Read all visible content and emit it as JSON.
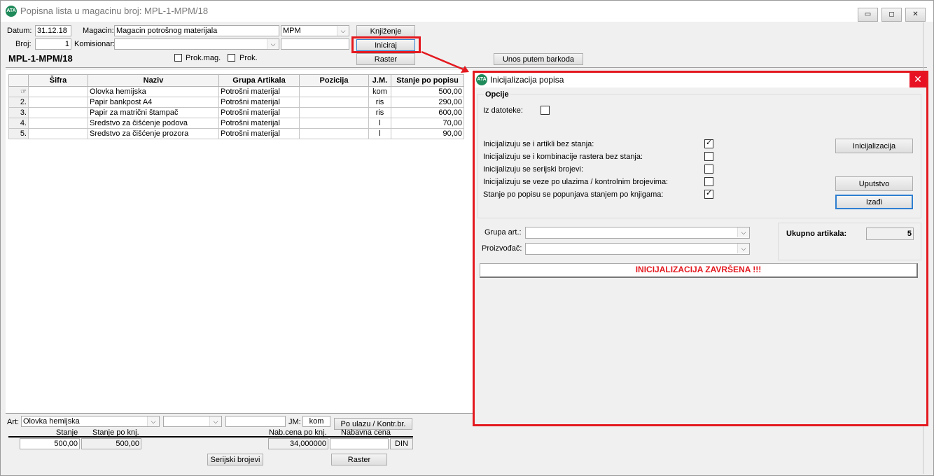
{
  "window": {
    "title": "Popisna lista u magacinu broj: MPL-1-MPM/18",
    "icon": "ATA"
  },
  "header": {
    "datum_label": "Datum:",
    "datum_value": "31.12.18",
    "magacin_label": "Magacin:",
    "magacin_value": "Magacin potrošnog materijala",
    "magacin_code": "MPM",
    "broj_label": "Broj:",
    "broj_value": "1",
    "komisionar_label": "Komisionar:",
    "komisionar_value": "",
    "komisionar_extra": "",
    "doc_number": "MPL-1-MPM/18",
    "prokmag_label": "Prok.mag.",
    "prok_label": "Prok.",
    "knjizenje_btn": "Knjiženje",
    "iniciraj_btn": "Iniciraj",
    "raster_btn": "Raster",
    "barkod_btn": "Unos putem barkoda"
  },
  "grid": {
    "columns": [
      "Šifra",
      "Naziv",
      "Grupa Artikala",
      "Pozicija",
      "J.M.",
      "Stanje po popisu"
    ],
    "rows": [
      {
        "no": "",
        "sifra": "",
        "naziv": "Olovka hemijska",
        "grupa": "Potrošni materijal",
        "pozicija": "",
        "jm": "kom",
        "stanje": "500,00"
      },
      {
        "no": "2.",
        "sifra": "",
        "naziv": "Papir bankpost A4",
        "grupa": "Potrošni materijal",
        "pozicija": "",
        "jm": "ris",
        "stanje": "290,00"
      },
      {
        "no": "3.",
        "sifra": "",
        "naziv": "Papir za matrični štampač",
        "grupa": "Potrošni materijal",
        "pozicija": "",
        "jm": "ris",
        "stanje": "600,00"
      },
      {
        "no": "4.",
        "sifra": "",
        "naziv": "Sredstvo za čišćenje podova",
        "grupa": "Potrošni materijal",
        "pozicija": "",
        "jm": "l",
        "stanje": "70,00"
      },
      {
        "no": "5.",
        "sifra": "",
        "naziv": "Sredstvo za čišćenje prozora",
        "grupa": "Potrošni materijal",
        "pozicija": "",
        "jm": "l",
        "stanje": "90,00"
      }
    ]
  },
  "footer": {
    "art_label": "Art:",
    "art_value": "Olovka hemijska",
    "art_combo2": "",
    "art_text": "",
    "jm_label": "JM:",
    "jm_value": "kom",
    "po_ulazu_btn": "Po ulazu / Kontr.br.",
    "stanje_label": "Stanje",
    "stanje_value": "500,00",
    "stanje_knj_label": "Stanje po knj.",
    "stanje_knj_value": "500,00",
    "nabcena_label": "Nab.cena po knj.",
    "nabcena_value": "34,000000",
    "nabavna_label": "Nabavna cena",
    "nabavna_value": "",
    "currency": "DIN",
    "serijski_btn": "Serijski brojevi",
    "raster_btn": "Raster"
  },
  "dialog": {
    "title": "Inicijalizacija popisa",
    "icon": "ATA",
    "close": "✕",
    "opcije_label": "Opcije",
    "iz_datoteke_label": "Iz datoteke:",
    "iz_datoteke_checked": false,
    "options": [
      {
        "label": "Inicijalizuju se i artikli bez stanja:",
        "checked": true
      },
      {
        "label": "Inicijalizuju se i kombinacije rastera bez stanja:",
        "checked": false
      },
      {
        "label": "Inicijalizuju se serijski brojevi:",
        "checked": false
      },
      {
        "label": "Inicijalizuju se veze po ulazima / kontrolnim brojevima:",
        "checked": false
      },
      {
        "label": "Stanje po popisu se popunjava stanjem po knjigama:",
        "checked": true
      }
    ],
    "inicijalizacija_btn": "Inicijalizacija",
    "uputstvo_btn": "Uputstvo",
    "izadji_btn": "Izađi",
    "grupa_label": "Grupa art.:",
    "grupa_value": "",
    "proizvodjac_label": "Proizvođač:",
    "proizvodjac_value": "",
    "ukupno_label": "Ukupno artikala:",
    "ukupno_value": "5",
    "status": "INICIJALIZACIJA ZAVRŠENA !!!"
  },
  "colors": {
    "highlight": "#e3191f",
    "close_button": "#e81123",
    "status_text": "#e3191f",
    "icon": "#1f8a5a"
  },
  "icons": {
    "minimize": "minimize-icon",
    "maximize": "maximize-icon",
    "close": "close-icon",
    "combo": "chevron-down-icon",
    "row_edit": "row-pointer-icon"
  }
}
